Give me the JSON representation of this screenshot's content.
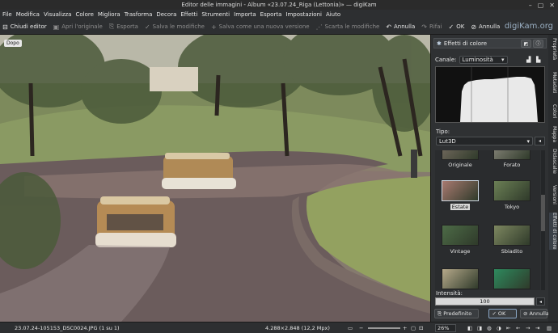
{
  "window": {
    "title": "Editor delle immagini - Album «23.07.24_Riga (Lettonia)» — digiKam"
  },
  "menu": [
    "File",
    "Modifica",
    "Visualizza",
    "Colore",
    "Migliora",
    "Trasforma",
    "Decora",
    "Effetti",
    "Strumenti",
    "Importa",
    "Esporta",
    "Impostazioni",
    "Aiuto"
  ],
  "toolbar": {
    "close_editor": "Chiudi editor",
    "open_original": "Apri l'originale",
    "export": "Esporta",
    "save_changes": "Salva le modifiche",
    "save_new_version": "Salva come una nuova versione",
    "discard_changes": "Scarta le modifiche",
    "undo": "Annulla",
    "redo": "Rifai",
    "ok": "OK",
    "cancel": "Annulla",
    "brand": "digiKam.org"
  },
  "canvas": {
    "view_badge": "Dopo"
  },
  "panel": {
    "title": "Effetti di colore",
    "channel_label": "Canale:",
    "channel_value": "Luminosità",
    "type_label": "Tipo:",
    "type_value": "Lut3D",
    "luts": [
      {
        "name": "Originale",
        "color": "#7a6f63"
      },
      {
        "name": "Forato",
        "color": "#8d8a7f"
      },
      {
        "name": "Estate",
        "color": "#a97a70"
      },
      {
        "name": "Tokyo",
        "color": "#6b7f55"
      },
      {
        "name": "Vintage",
        "color": "#4d6b47"
      },
      {
        "name": "Sbiadito",
        "color": "#7d8760"
      },
      {
        "name": "",
        "color": "#b6a98a"
      },
      {
        "name": "",
        "color": "#2e8a5e"
      }
    ],
    "selected_lut": "Estate",
    "intensity_label": "Intensità:",
    "intensity_value": "100",
    "default_button": "Predefinito",
    "ok_button": "OK",
    "cancel_button": "Annulla"
  },
  "side_tabs": [
    "Proprietà",
    "Metadati",
    "Colori",
    "Mappa",
    "Didascalie",
    "Versioni",
    "Effetti di colore"
  ],
  "status": {
    "filename": "23.07.24-105153_DSC0024.JPG (1 su 1)",
    "dimensions": "4.288×2.848 (12,2 Mpx)",
    "zoom": "26%"
  }
}
